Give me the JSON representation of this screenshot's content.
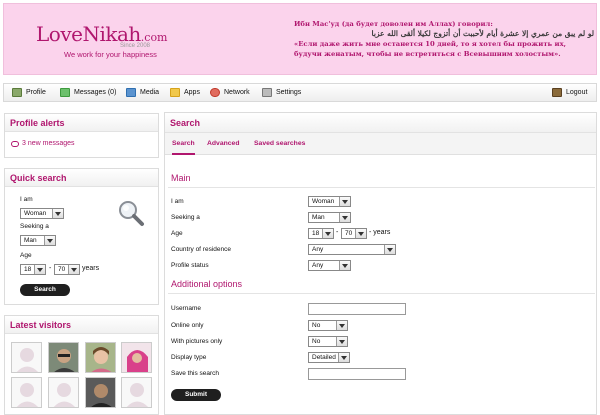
{
  "header": {
    "logo_name": "LoveNikah",
    "logo_domain": ".com",
    "logo_since": "Since 2008",
    "tagline": "We work for your happiness",
    "quote_title": "Ибн Мас'уд (да будет доволен им Аллах) говорил:",
    "quote_arabic": "لو لم يبق من عمري إلا عشرة أيام لأحببت أن أتزوج لكيلا ألقى الله عزبا",
    "quote_text": "«Если даже жить мне останется 10 дней, то я хотел бы прожить их, будучи женатым, чтобы не встретиться с Всевышним холостым»."
  },
  "nav": {
    "items": [
      {
        "label": "Profile",
        "icon": "profile-icon",
        "color": "#5a8a3a"
      },
      {
        "label": "Messages (0)",
        "icon": "messages-icon",
        "color": "#3d9a3d"
      },
      {
        "label": "Media",
        "icon": "media-icon",
        "color": "#2f6fb0"
      },
      {
        "label": "Apps",
        "icon": "apps-icon",
        "color": "#d6a21a"
      },
      {
        "label": "Network",
        "icon": "network-icon",
        "color": "#c0392b"
      },
      {
        "label": "Settings",
        "icon": "settings-icon",
        "color": "#777777"
      }
    ],
    "logout": "Logout"
  },
  "alerts": {
    "title": "Profile alerts",
    "new_messages": "3 new messages"
  },
  "quick_search": {
    "title": "Quick search",
    "i_am_label": "I am",
    "i_am_value": "Woman",
    "seeking_label": "Seeking a",
    "seeking_value": "Man",
    "age_label": "Age",
    "age_from": "18",
    "age_to": "70",
    "age_sep": "-",
    "age_unit": "years",
    "button": "Search"
  },
  "visitors": {
    "title": "Latest visitors"
  },
  "search": {
    "title": "Search",
    "tabs": [
      "Search",
      "Advanced",
      "Saved searches"
    ],
    "main_title": "Main",
    "i_am_label": "I am",
    "i_am_value": "Woman",
    "seeking_label": "Seeking a",
    "seeking_value": "Man",
    "age_label": "Age",
    "age_from": "18",
    "age_to": "70",
    "age_sep": "-",
    "age_unit": "- years",
    "country_label": "Country of residence",
    "country_value": "Any",
    "status_label": "Profile status",
    "status_value": "Any",
    "additional_title": "Additional options",
    "username_label": "Username",
    "online_label": "Online only",
    "online_value": "No",
    "pictures_label": "With pictures only",
    "pictures_value": "No",
    "display_label": "Display type",
    "display_value": "Detailed",
    "save_label": "Save this search",
    "submit": "Submit"
  },
  "colors": {
    "brand": "#b0166e",
    "header_bg": "#fbd3ec"
  }
}
